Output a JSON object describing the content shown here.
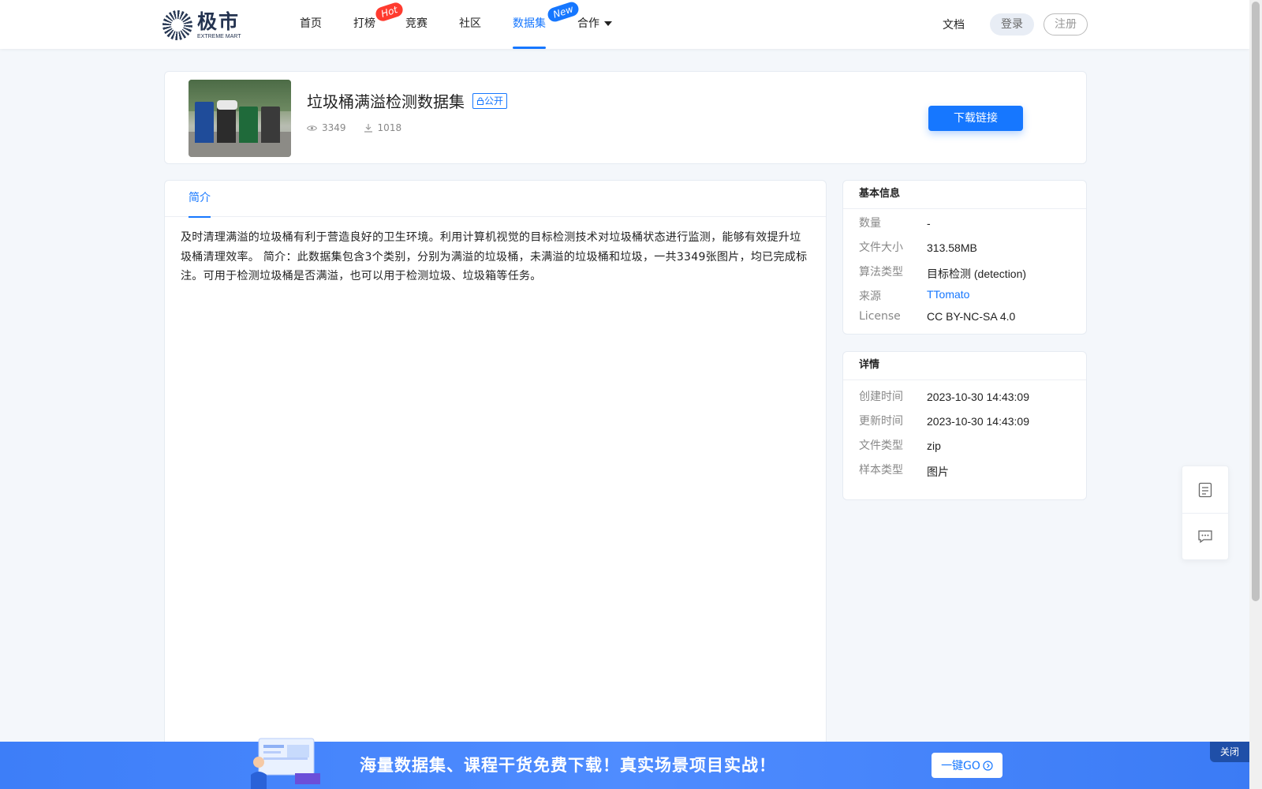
{
  "header": {
    "logo_cn": "极市",
    "logo_en": "EXTREME MART",
    "nav": [
      {
        "label": "首页",
        "badge": ""
      },
      {
        "label": "打榜",
        "badge": "Hot"
      },
      {
        "label": "竞赛",
        "badge": ""
      },
      {
        "label": "社区",
        "badge": ""
      },
      {
        "label": "数据集",
        "badge": "New"
      },
      {
        "label": "合作",
        "badge": ""
      }
    ],
    "docs": "文档",
    "login": "登录",
    "register": "注册"
  },
  "dataset": {
    "title": "垃圾桶满溢检测数据集",
    "visibility": "公开",
    "views": "3349",
    "downloads": "1018",
    "download_button": "下载链接"
  },
  "tabs": {
    "intro": "简介"
  },
  "intro_text": "及时清理满溢的垃圾桶有利于营造良好的卫生环境。利用计算机视觉的目标检测技术对垃圾桶状态进行监测，能够有效提升垃圾桶清理效率。 简介：此数据集包含3个类别，分别为满溢的垃圾桶，未满溢的垃圾桶和垃圾，一共3349张图片，均已完成标注。可用于检测垃圾桶是否满溢，也可以用于检测垃圾、垃圾箱等任务。",
  "basic_info": {
    "title": "基本信息",
    "rows": [
      {
        "key": "数量",
        "value": "-"
      },
      {
        "key": "文件大小",
        "value": "313.58MB"
      },
      {
        "key": "算法类型",
        "value": "目标检测 (detection)"
      },
      {
        "key": "来源",
        "value": "TTomato"
      },
      {
        "key": "License",
        "value": "CC BY-NC-SA 4.0"
      }
    ]
  },
  "details": {
    "title": "详情",
    "rows": [
      {
        "key": "创建时间",
        "value": "2023-10-30 14:43:09"
      },
      {
        "key": "更新时间",
        "value": "2023-10-30 14:43:09"
      },
      {
        "key": "文件类型",
        "value": "zip"
      },
      {
        "key": "样本类型",
        "value": "图片"
      }
    ]
  },
  "banner": {
    "text": "海量数据集、课程干货免费下载！真实场景项目实战！",
    "go": "一键GO",
    "close": "关闭"
  },
  "colors": {
    "accent": "#1677ff",
    "hot": "#ff3b2f",
    "banner": "#4f8cff"
  },
  "icons": [
    "eye-icon",
    "download-icon",
    "lock-icon",
    "caret-down-icon",
    "document-icon",
    "comment-icon",
    "arrow-right-circle-icon"
  ]
}
